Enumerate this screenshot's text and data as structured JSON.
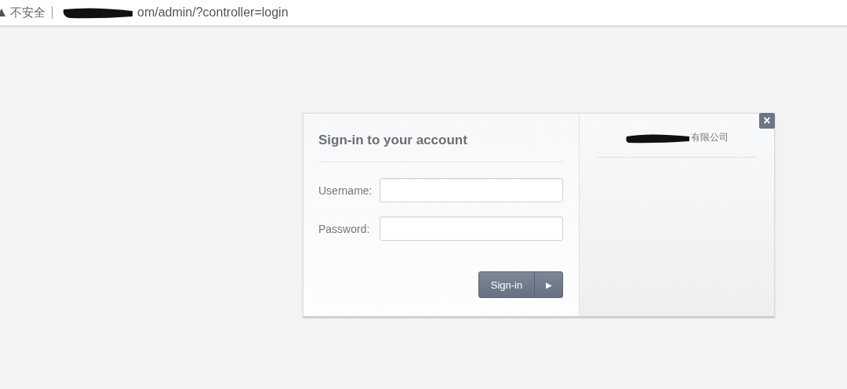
{
  "address_bar": {
    "security_label": "不安全",
    "url": "om/admin/?controller=login"
  },
  "login": {
    "title": "Sign-in to your account",
    "fields": [
      {
        "label": "Username:"
      },
      {
        "label": "Password:"
      }
    ],
    "submit": {
      "label": "Sign-in",
      "arrow": "▶"
    },
    "close": "×",
    "company": "有限公司"
  }
}
